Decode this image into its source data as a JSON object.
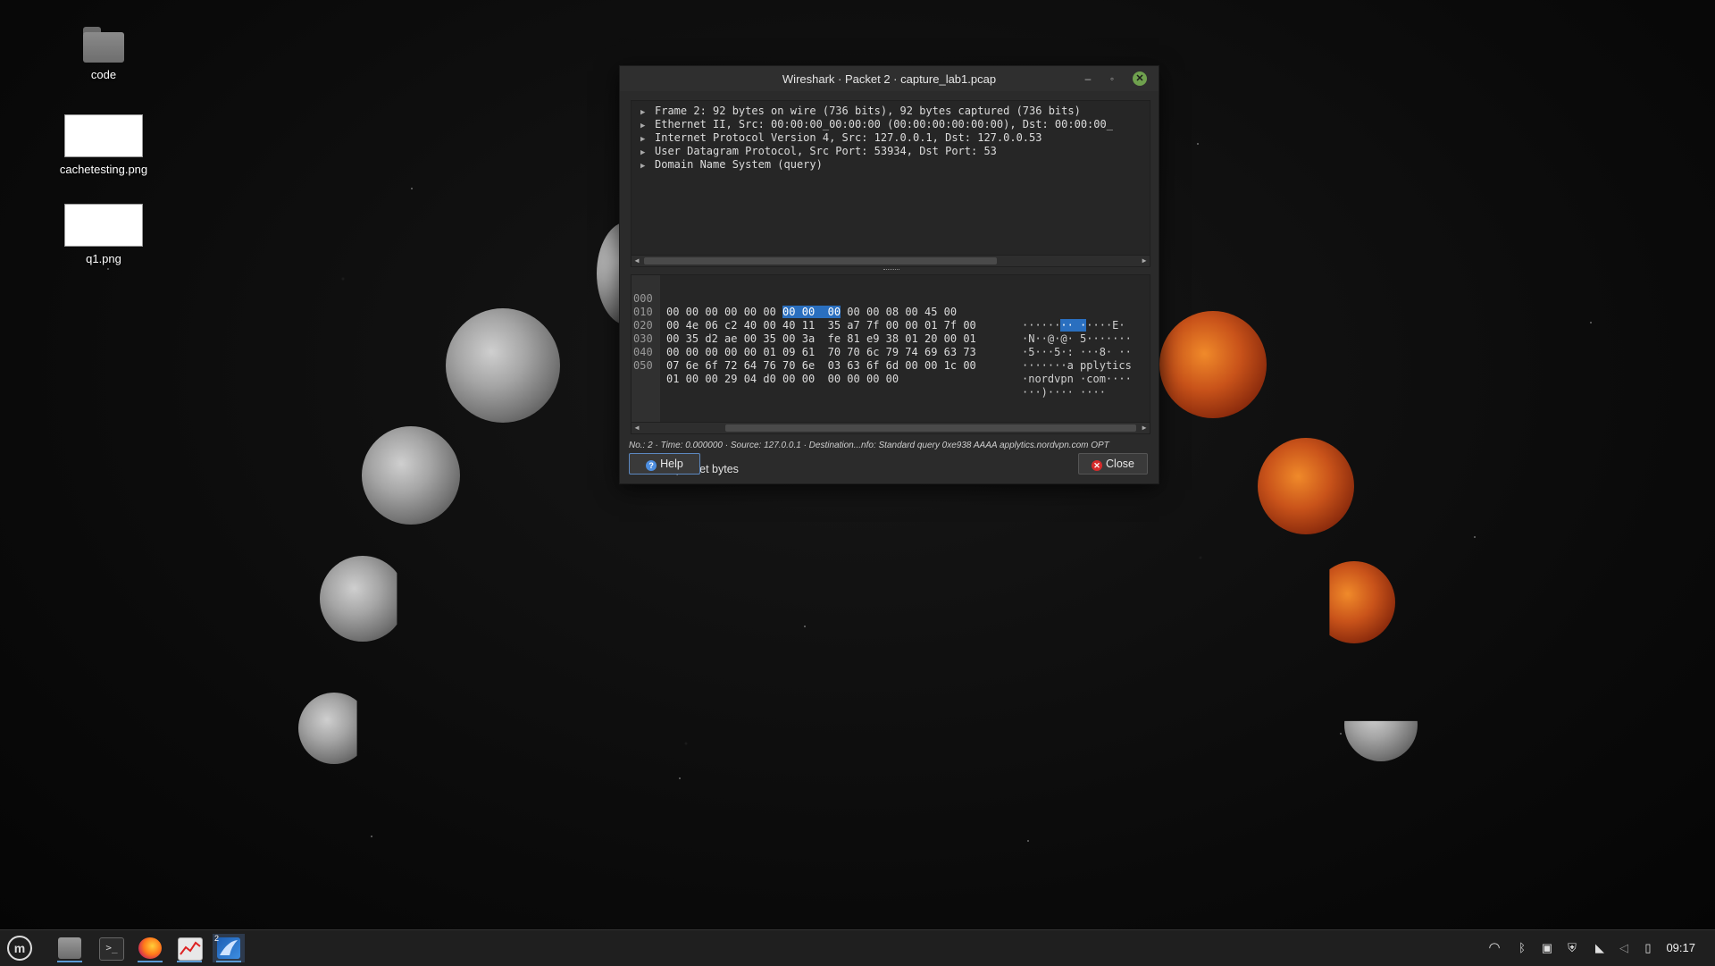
{
  "desktop": {
    "icons": [
      {
        "label": "code",
        "type": "folder"
      },
      {
        "label": "cachetesting.png",
        "type": "image"
      },
      {
        "label": "q1.png",
        "type": "image"
      }
    ]
  },
  "dialog": {
    "title": "Wireshark · Packet 2 · capture_lab1.pcap",
    "window_buttons": {
      "minimize": "–",
      "maximize": "◦",
      "close": "✕"
    },
    "tree": [
      "Frame 2: 92 bytes on wire (736 bits), 92 bytes captured (736 bits)",
      "Ethernet II, Src: 00:00:00_00:00:00 (00:00:00:00:00:00), Dst: 00:00:00_",
      "Internet Protocol Version 4, Src: 127.0.0.1, Dst: 127.0.0.53",
      "User Datagram Protocol, Src Port: 53934, Dst Port: 53",
      "Domain Name System (query)"
    ],
    "bytes": [
      {
        "off": "000",
        "hex_a": "00 00 00 00 00 00 ",
        "hex_hl": "00 00  00",
        "hex_b": " 00 00 08 00 45 00",
        "asc_a": "······",
        "asc_hl": "·· ·",
        "asc_b": "····E·"
      },
      {
        "off": "010",
        "hex_a": "00 4e 06 c2 40 00 40 11  35 a7 7f 00 00 01 7f 00",
        "hex_hl": "",
        "hex_b": "",
        "asc_a": "·N··@·@· 5·······",
        "asc_hl": "",
        "asc_b": ""
      },
      {
        "off": "020",
        "hex_a": "00 35 d2 ae 00 35 00 3a  fe 81 e9 38 01 20 00 01",
        "hex_hl": "",
        "hex_b": "",
        "asc_a": "·5···5·: ···8· ··",
        "asc_hl": "",
        "asc_b": ""
      },
      {
        "off": "030",
        "hex_a": "00 00 00 00 00 01 09 61  70 70 6c 79 74 69 63 73",
        "hex_hl": "",
        "hex_b": "",
        "asc_a": "·······a pplytics",
        "asc_hl": "",
        "asc_b": ""
      },
      {
        "off": "040",
        "hex_a": "07 6e 6f 72 64 76 70 6e  03 63 6f 6d 00 00 1c 00",
        "hex_hl": "",
        "hex_b": "",
        "asc_a": "·nordvpn ·com····",
        "asc_hl": "",
        "asc_b": ""
      },
      {
        "off": "050",
        "hex_a": "01 00 00 29 04 d0 00 00  00 00 00 00",
        "hex_hl": "",
        "hex_b": "",
        "asc_a": "···)···· ····",
        "asc_hl": "",
        "asc_b": ""
      }
    ],
    "status": "No.: 2 · Time: 0.000000 · Source: 127.0.0.1 · Destination...nfo: Standard query 0xe938 AAAA applytics.nordvpn.com OPT",
    "show_bytes_label": "Show packet bytes",
    "show_bytes_checked": "✓",
    "help_label": "Help",
    "close_label": "Close"
  },
  "taskbar": {
    "apps": [
      "menu-icon",
      "files-icon",
      "terminal-icon",
      "firefox-icon",
      "graph-app-icon",
      "wireshark-icon"
    ],
    "wireshark_badge": "2",
    "clock": "09:17"
  },
  "colors": {
    "highlight": "#2a6fbf",
    "dialog_bg": "#2b2b2b",
    "accent": "#5b9bd5"
  }
}
